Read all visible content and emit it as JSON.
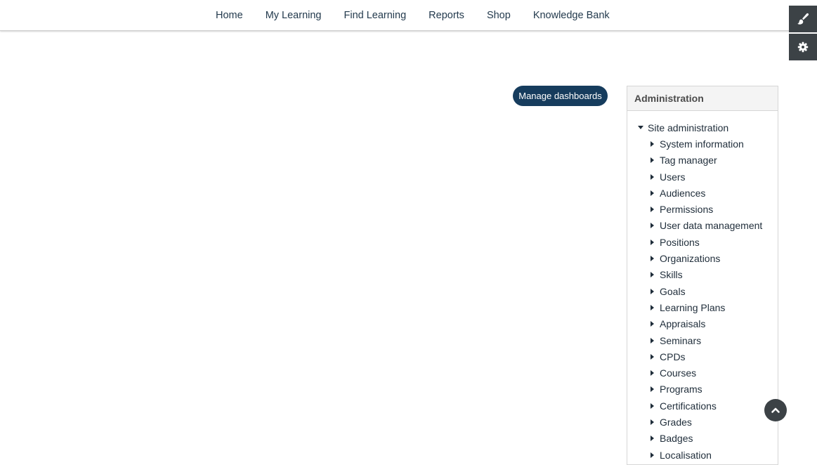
{
  "nav": {
    "items": [
      "Home",
      "My Learning",
      "Find Learning",
      "Reports",
      "Shop",
      "Knowledge Bank"
    ]
  },
  "tools": {
    "icons": [
      "paintbrush-icon",
      "gear-icon"
    ]
  },
  "dashboard": {
    "manage_label": "Manage dashboards"
  },
  "admin": {
    "title": "Administration",
    "root": "Site administration",
    "items": [
      "System information",
      "Tag manager",
      "Users",
      "Audiences",
      "Permissions",
      "User data management",
      "Positions",
      "Organizations",
      "Skills",
      "Goals",
      "Learning Plans",
      "Appraisals",
      "Seminars",
      "CPDs",
      "Courses",
      "Programs",
      "Certifications",
      "Grades",
      "Badges",
      "Localisation"
    ]
  },
  "colors": {
    "button_bg": "#163c5d",
    "tool_bg": "#3c4246",
    "text": "#1f2d3a"
  }
}
